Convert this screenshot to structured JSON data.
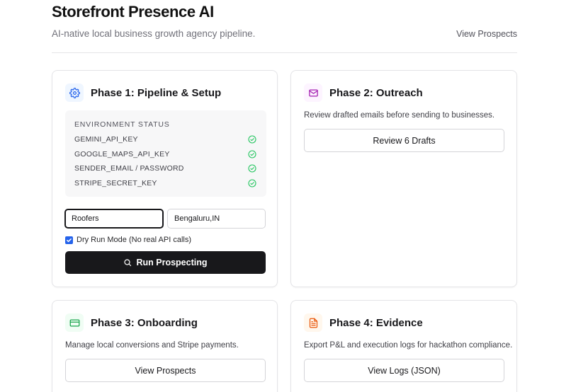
{
  "header": {
    "title": "Storefront Presence AI",
    "subtitle": "AI-native local business growth agency pipeline.",
    "link": "View Prospects"
  },
  "phase1": {
    "title": "Phase 1: Pipeline & Setup",
    "icon": "gear-icon",
    "env_heading": "ENVIRONMENT STATUS",
    "env_keys": [
      {
        "name": "GEMINI_API_KEY",
        "status": "ok"
      },
      {
        "name": "GOOGLE_MAPS_API_KEY",
        "status": "ok"
      },
      {
        "name": "SENDER_EMAIL / PASSWORD",
        "status": "ok"
      },
      {
        "name": "STRIPE_SECRET_KEY",
        "status": "ok"
      }
    ],
    "category_value": "Roofers",
    "location_value": "Bengaluru,IN",
    "dry_run_label": "Dry Run Mode (No real API calls)",
    "dry_run_checked": true,
    "run_button": "Run Prospecting"
  },
  "phase2": {
    "title": "Phase 2: Outreach",
    "icon": "mail-icon",
    "description": "Review drafted emails before sending to businesses.",
    "button": "Review 6 Drafts"
  },
  "phase3": {
    "title": "Phase 3: Onboarding",
    "icon": "credit-card-icon",
    "description": "Manage local conversions and Stripe payments.",
    "button": "View Prospects"
  },
  "phase4": {
    "title": "Phase 4: Evidence",
    "icon": "file-text-icon",
    "description": "Export P&L and execution logs for hackathon compliance.",
    "button": "View Logs (JSON)"
  },
  "colors": {
    "phase1_icon": "#2563eb",
    "phase2_icon": "#a21caf",
    "phase3_icon": "#16a34a",
    "phase4_icon": "#ea580c",
    "status_ok": "#22c55e",
    "primary": "#18181b"
  }
}
